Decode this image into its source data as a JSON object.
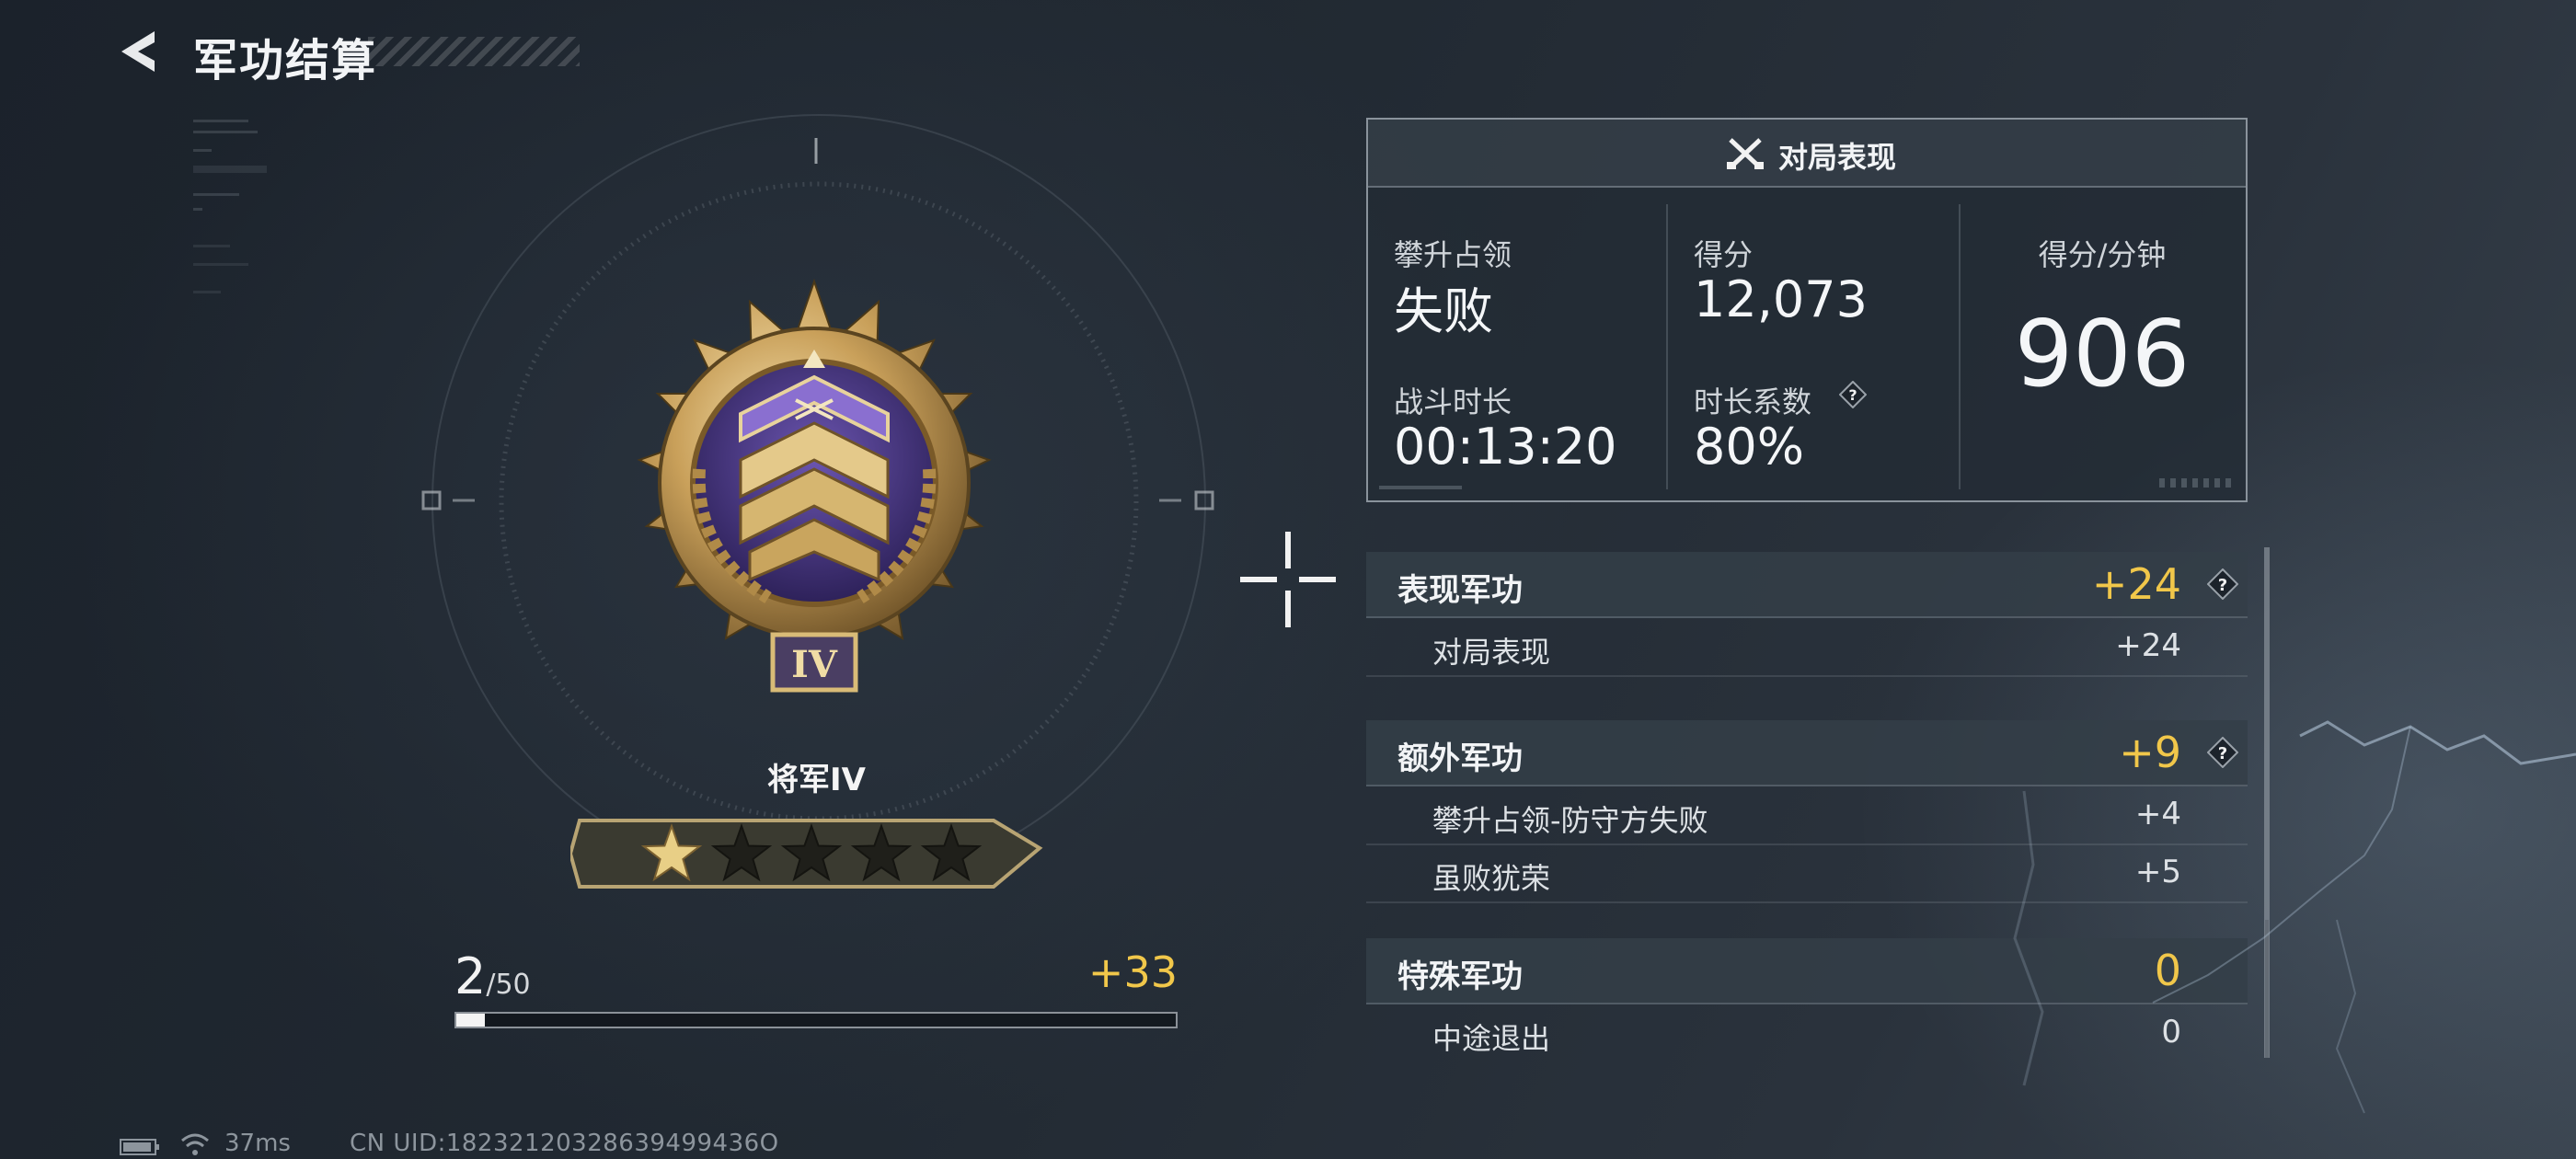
{
  "header": {
    "title": "军功结算"
  },
  "rank": {
    "name": "将军IV",
    "numeral": "IV",
    "stars_total": 5,
    "stars_filled": 1,
    "progress_current": "2",
    "progress_total": "/50",
    "progress_fraction": 0.04,
    "gain": "+33"
  },
  "match": {
    "title": "对局表现",
    "mode_label": "攀升占领",
    "mode_result": "失败",
    "score_label": "得分",
    "score_value": "12,073",
    "duration_label": "战斗时长",
    "duration_value": "00:13:20",
    "factor_label": "时长系数",
    "factor_value": "80%",
    "spm_label": "得分/分钟",
    "spm_value": "906"
  },
  "merits": [
    {
      "title": "表现军功",
      "total": "+24",
      "items": [
        {
          "label": "对局表现",
          "value": "+24"
        }
      ]
    },
    {
      "title": "额外军功",
      "total": "+9",
      "items": [
        {
          "label": "攀升占领-防守方失败",
          "value": "+4"
        },
        {
          "label": "虽败犹荣",
          "value": "+5"
        }
      ]
    },
    {
      "title": "特殊军功",
      "total": "0",
      "items": [
        {
          "label": "中途退出",
          "value": "0"
        }
      ]
    }
  ],
  "status": {
    "ping": "37ms",
    "uid": "CN UID:18232120328639499436O"
  },
  "colors": {
    "accent_gold": "#f1c74a",
    "medal_purple": "#4b3a86",
    "medal_gold": "#d4ad63"
  }
}
